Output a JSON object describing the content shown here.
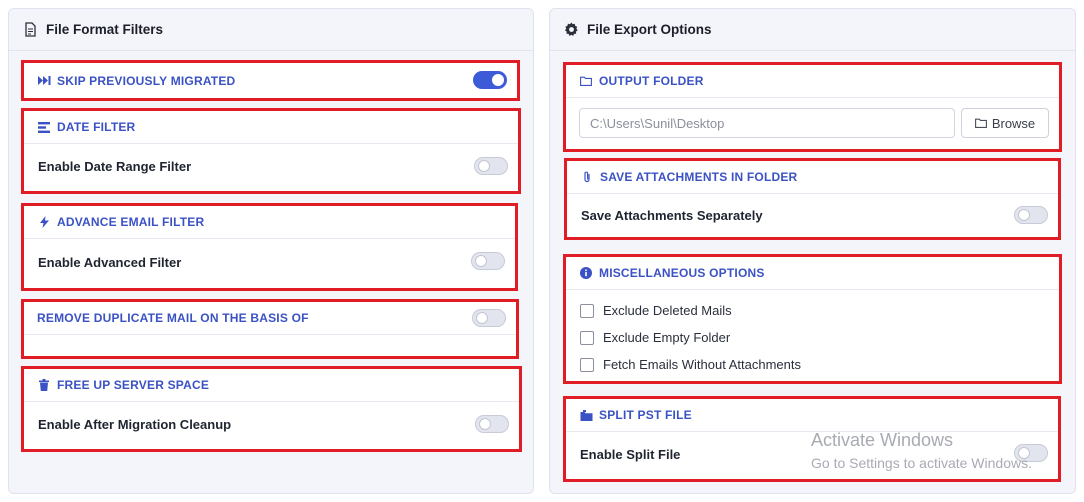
{
  "left_panel": {
    "title": "File Format Filters",
    "title_icon": "document-icon",
    "cards": {
      "skip_migrated": {
        "title": "SKIP PREVIOUSLY MIGRATED",
        "icon": "fast-forward-icon",
        "toggle_on": true
      },
      "date_filter": {
        "title": "DATE FILTER",
        "icon": "filter-bars-icon",
        "option_label": "Enable Date Range Filter",
        "toggle_on": false
      },
      "advance_email": {
        "title": "ADVANCE EMAIL FILTER",
        "icon": "lightning-icon",
        "option_label": "Enable Advanced Filter",
        "toggle_on": false
      },
      "remove_duplicate": {
        "title": "REMOVE DUPLICATE MAIL ON THE BASIS OF",
        "toggle_on": false
      },
      "free_up_space": {
        "title": "FREE UP SERVER SPACE",
        "icon": "trash-icon",
        "option_label": "Enable After Migration Cleanup",
        "toggle_on": false
      }
    }
  },
  "right_panel": {
    "title": "File Export Options",
    "title_icon": "gear-icon",
    "cards": {
      "output_folder": {
        "title": "OUTPUT FOLDER",
        "icon": "folder-icon",
        "path_value": "C:\\Users\\Sunil\\Desktop",
        "browse_label": "Browse"
      },
      "save_attachments": {
        "title": "SAVE ATTACHMENTS IN FOLDER",
        "icon": "paperclip-icon",
        "option_label": "Save Attachments Separately",
        "toggle_on": false
      },
      "misc_options": {
        "title": "MISCELLANEOUS OPTIONS",
        "icon": "info-icon",
        "options": [
          {
            "label": "Exclude Deleted Mails",
            "checked": false
          },
          {
            "label": "Exclude Empty Folder",
            "checked": false
          },
          {
            "label": "Fetch Emails Without Attachments",
            "checked": false
          }
        ]
      },
      "split_pst": {
        "title": "SPLIT PST FILE",
        "icon": "split-file-icon",
        "option_label": "Enable Split File",
        "toggle_on": false
      }
    }
  },
  "watermark": {
    "line1": "Activate Windows",
    "line2": "Go to Settings to activate Windows."
  },
  "colors": {
    "accent": "#3b52c4",
    "highlight_border": "#e01c24",
    "toggle_on": "#3d5bd9",
    "panel_bg": "#f4f5fb"
  }
}
